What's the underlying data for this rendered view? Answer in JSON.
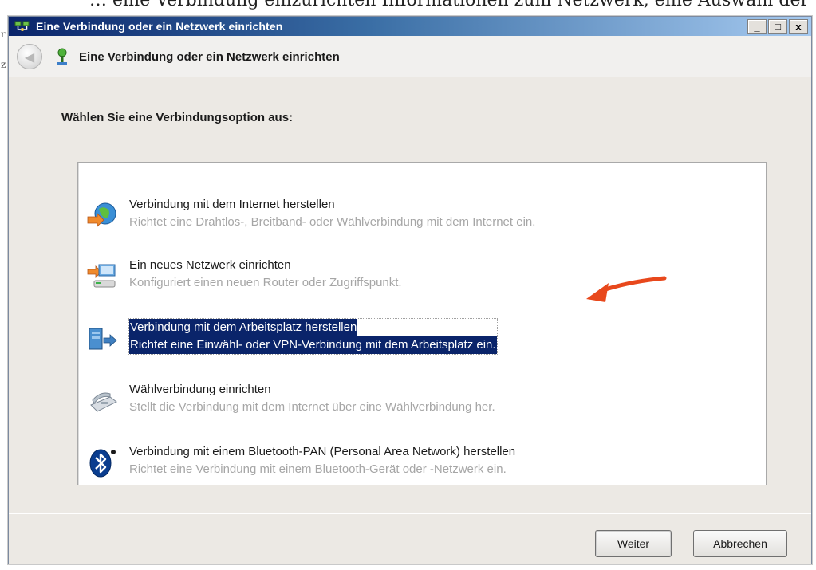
{
  "background": {
    "top_text": "… eine Verbindung einzurichten Informationen zum Netzwerk, eine Auswahl der Verbindung",
    "edge_marks": [
      "r",
      "z"
    ]
  },
  "dialog": {
    "title": "Eine Verbindung oder ein Netzwerk einrichten",
    "window_buttons": {
      "minimize": "_",
      "maximize": "□",
      "close": "x"
    },
    "header_title": "Eine Verbindung oder ein Netzwerk einrichten",
    "instruction": "Wählen Sie eine Verbindungsoption aus:",
    "options": [
      {
        "icon": "globe-network-icon",
        "title": "Verbindung mit dem Internet herstellen",
        "description": "Richtet eine Drahtlos-, Breitband- oder Wählverbindung mit dem Internet ein.",
        "selected": false
      },
      {
        "icon": "router-icon",
        "title": "Ein neues Netzwerk einrichten",
        "description": "Konfiguriert einen neuen Router oder Zugriffspunkt.",
        "selected": false
      },
      {
        "icon": "workplace-vpn-icon",
        "title": "Verbindung mit dem Arbeitsplatz herstellen",
        "description": "Richtet eine Einwähl- oder VPN-Verbindung mit dem Arbeitsplatz ein.",
        "selected": true
      },
      {
        "icon": "dialup-modem-icon",
        "title": "Wählverbindung einrichten",
        "description": "Stellt die Verbindung mit dem Internet über eine Wählverbindung her.",
        "selected": false
      },
      {
        "icon": "bluetooth-icon",
        "title": "Verbindung mit einem Bluetooth-PAN (Personal Area Network) herstellen",
        "description": "Richtet eine Verbindung mit einem Bluetooth-Gerät oder -Netzwerk ein.",
        "selected": false
      }
    ],
    "buttons": {
      "next": "Weiter",
      "cancel": "Abbrechen"
    }
  },
  "colors": {
    "selection": "#0a246a",
    "annotation_arrow": "#e8481c",
    "description_text": "#a6a6a6"
  }
}
